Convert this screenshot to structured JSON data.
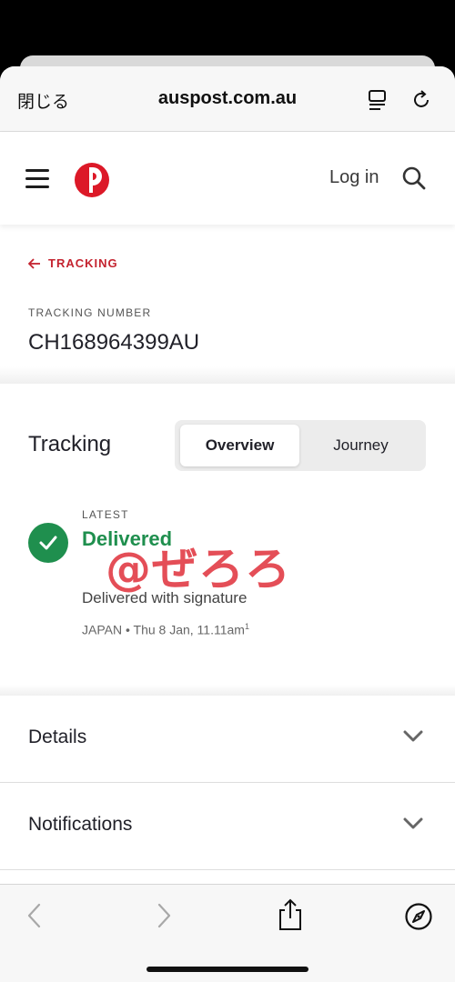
{
  "browser": {
    "close_label": "閉じる",
    "url": "auspost.com.au"
  },
  "site": {
    "login_label": "Log in",
    "brand_color": "#dc1928"
  },
  "tracking": {
    "back_label": "TRACKING",
    "number_label": "TRACKING NUMBER",
    "number_value": "CH168964399AU",
    "section_title": "Tracking",
    "tabs": [
      {
        "label": "Overview",
        "selected": true
      },
      {
        "label": "Journey",
        "selected": false
      }
    ],
    "latest_label": "LATEST",
    "status": "Delivered",
    "status_color": "#1f8f4e",
    "description": "Delivered with signature",
    "meta": "JAPAN • Thu 8 Jan, 11.11am",
    "meta_footnote": "1"
  },
  "watermark": "@ぜろろ",
  "accordions": [
    {
      "label": "Details"
    },
    {
      "label": "Notifications"
    }
  ],
  "toolbar": {
    "icons": [
      "back-icon",
      "forward-icon",
      "share-icon",
      "compass-icon"
    ]
  }
}
